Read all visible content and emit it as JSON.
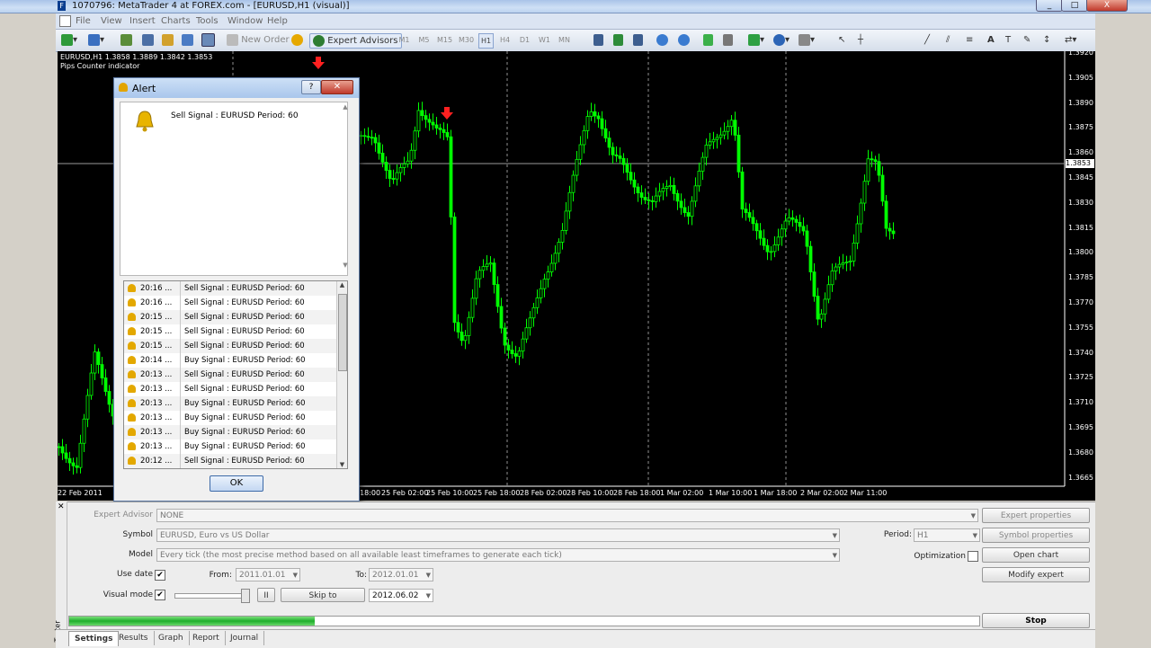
{
  "window": {
    "title": "1070796: MetaTrader 4 at FOREX.com - [EURUSD,H1 (visual)]",
    "min": "_",
    "max": "□",
    "close": "X"
  },
  "menu": [
    "File",
    "View",
    "Insert",
    "Charts",
    "Tools",
    "Window",
    "Help"
  ],
  "toolbar": {
    "new_order": "New Order",
    "expert_advisors": "Expert Advisors",
    "timeframes": [
      "M1",
      "M5",
      "M15",
      "M30",
      "H1",
      "H4",
      "D1",
      "W1",
      "MN"
    ],
    "active_timeframe": "H1"
  },
  "chart": {
    "symbol_line": "EURUSD,H1  1.3858 1.3889 1.3842 1.3853",
    "indicator_name": "Pips Counter indicator",
    "current_price": "1.3853",
    "price_axis": [
      "1.3920",
      "1.3905",
      "1.3890",
      "1.3875",
      "1.3860",
      "1.3845",
      "1.3830",
      "1.3815",
      "1.3800",
      "1.3785",
      "1.3770",
      "1.3755",
      "1.3740",
      "1.3725",
      "1.3710",
      "1.3695",
      "1.3680",
      "1.3665"
    ],
    "time_axis": [
      "22 Feb 2011",
      "18:00",
      "25 Feb 02:00",
      "25 Feb 10:00",
      "25 Feb 18:00",
      "28 Feb 02:00",
      "28 Feb 10:00",
      "28 Feb 18:00",
      "1 Mar 02:00",
      "1 Mar 10:00",
      "1 Mar 18:00",
      "2 Mar 02:00",
      "2 Mar 11:00"
    ],
    "colors": {
      "bull": "#00ff00",
      "bear": "#00ff00",
      "signal_arrow": "#ff2020",
      "grid": "#8f8f8f"
    }
  },
  "alert": {
    "title": "Alert",
    "help": "?",
    "close": "✕",
    "message": "Sell Signal : EURUSD  Period: 60",
    "rows": [
      {
        "time": "20:16 ...",
        "text": "Sell Signal : EURUSD  Period: 60"
      },
      {
        "time": "20:16 ...",
        "text": "Sell Signal : EURUSD  Period: 60"
      },
      {
        "time": "20:15 ...",
        "text": "Sell Signal : EURUSD  Period: 60"
      },
      {
        "time": "20:15 ...",
        "text": "Sell Signal : EURUSD  Period: 60"
      },
      {
        "time": "20:15 ...",
        "text": "Sell Signal : EURUSD  Period: 60"
      },
      {
        "time": "20:14 ...",
        "text": "Buy Signal : EURUSD  Period: 60"
      },
      {
        "time": "20:13 ...",
        "text": "Sell Signal : EURUSD  Period: 60"
      },
      {
        "time": "20:13 ...",
        "text": "Sell Signal : EURUSD  Period: 60"
      },
      {
        "time": "20:13 ...",
        "text": "Buy Signal : EURUSD  Period: 60"
      },
      {
        "time": "20:13 ...",
        "text": "Buy Signal : EURUSD  Period: 60"
      },
      {
        "time": "20:13 ...",
        "text": "Buy Signal : EURUSD  Period: 60"
      },
      {
        "time": "20:13 ...",
        "text": "Buy Signal : EURUSD  Period: 60"
      },
      {
        "time": "20:12 ...",
        "text": "Sell Signal : EURUSD  Period: 60"
      }
    ],
    "ok": "OK"
  },
  "tester": {
    "expert_label": "Expert Advisor",
    "expert_value": "NONE",
    "symbol_label": "Symbol",
    "symbol_value": "EURUSD, Euro vs US Dollar",
    "model_label": "Model",
    "model_value": "Every tick (the most precise method based on all available least timeframes to generate each tick)",
    "use_date_label": "Use date",
    "use_date_checked": "✔",
    "from_label": "From:",
    "from_value": "2011.01.01",
    "to_label": "To:",
    "to_value": "2012.01.01",
    "visual_label": "Visual mode",
    "visual_checked": "✔",
    "pause": "II",
    "skip_to": "Skip to",
    "skip_date": "2012.06.02",
    "period_label": "Period:",
    "period_value": "H1",
    "optimization_label": "Optimization",
    "btn_expert_props": "Expert properties",
    "btn_symbol_props": "Symbol properties",
    "btn_open_chart": "Open chart",
    "btn_modify": "Modify expert",
    "btn_stop": "Stop",
    "progress": 0.27,
    "side_label": "Tester"
  },
  "tabs": [
    "Settings",
    "Results",
    "Graph",
    "Report",
    "Journal"
  ]
}
